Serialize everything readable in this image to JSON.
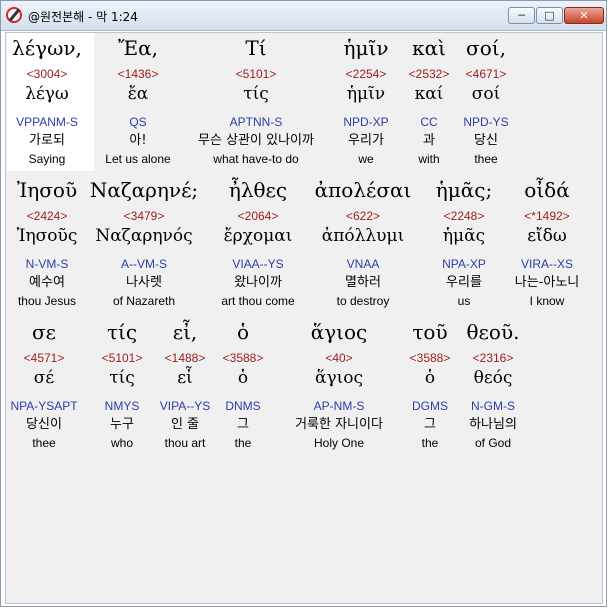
{
  "window": {
    "title": "@원전본해 - 막 1:24"
  },
  "rows": [
    [
      {
        "greek": "λέγων,",
        "num": "<3004>",
        "lemma": "λέγω",
        "parse": "VPPANM-S",
        "kor": "가로되",
        "eng": "Saying"
      },
      {
        "greek": "Ἔα,",
        "num": "<1436>",
        "lemma": "ἔα",
        "parse": "QS",
        "kor": "아!",
        "eng": "Let us alone"
      },
      {
        "greek": "Τί",
        "num": "<5101>",
        "lemma": "τίς",
        "parse": "APTNN-S",
        "kor": "무슨 상관이 있나이까",
        "eng": "what have-to do"
      },
      {
        "greek": "ἡμῖν",
        "num": "<2254>",
        "lemma": "ἡμῖν",
        "parse": "NPD-XP",
        "kor": "우리가",
        "eng": "we"
      },
      {
        "greek": "καὶ",
        "num": "<2532>",
        "lemma": "καί",
        "parse": "CC",
        "kor": "과",
        "eng": "with"
      },
      {
        "greek": "σοί,",
        "num": "<4671>",
        "lemma": "σοί",
        "parse": "NPD-YS",
        "kor": "당신",
        "eng": "thee"
      }
    ],
    [
      {
        "greek": "Ἰησοῦ",
        "num": "<2424>",
        "lemma": "Ἰησοῦς",
        "parse": "N-VM-S",
        "kor": "예수여",
        "eng": "thou Jesus"
      },
      {
        "greek": "Ναζαρηνέ;",
        "num": "<3479>",
        "lemma": "Ναζαρηνός",
        "parse": "A--VM-S",
        "kor": "나사렛",
        "eng": "of Nazareth"
      },
      {
        "greek": "ἦλθες",
        "num": "<2064>",
        "lemma": "ἔρχομαι",
        "parse": "VIAA--YS",
        "kor": "왔나이까",
        "eng": "art thou come"
      },
      {
        "greek": "ἀπολέσαι",
        "num": "<622>",
        "lemma": "ἀπόλλυμι",
        "parse": "VNAA",
        "kor": "멸하러",
        "eng": "to destroy"
      },
      {
        "greek": "ἡμᾶς;",
        "num": "<2248>",
        "lemma": "ἡμᾶς",
        "parse": "NPA-XP",
        "kor": "우리를",
        "eng": "us"
      },
      {
        "greek": "οἶδά",
        "num": "<*1492>",
        "lemma": "εἴδω",
        "parse": "VIRA--XS",
        "kor": "나는-아노니",
        "eng": "I know"
      }
    ],
    [
      {
        "greek": "σε",
        "num": "<4571>",
        "lemma": "σέ",
        "parse": "NPA-YSAPT",
        "kor": "당신이",
        "eng": "thee"
      },
      {
        "greek": "τίς",
        "num": "<5101>",
        "lemma": "τίς",
        "parse": "NMYS",
        "kor": "누구",
        "eng": "who"
      },
      {
        "greek": "εἶ,",
        "num": "<1488>",
        "lemma": "εἶ",
        "parse": "VIPA--YS",
        "kor": "인 줄",
        "eng": "thou art"
      },
      {
        "greek": "ὁ",
        "num": "<3588>",
        "lemma": "ὁ",
        "parse": "DNMS",
        "kor": "그",
        "eng": "the"
      },
      {
        "greek": "ἅγιος",
        "num": "<40>",
        "lemma": "ἅγιος",
        "parse": "AP-NM-S",
        "kor": "거룩한 자니이다",
        "eng": "Holy One"
      },
      {
        "greek": "τοῦ",
        "num": "<3588>",
        "lemma": "ὁ",
        "parse": "DGMS",
        "kor": "그",
        "eng": "the"
      },
      {
        "greek": "θεοῦ.",
        "num": "<2316>",
        "lemma": "θεός",
        "parse": "N-GM-S",
        "kor": "하나님의",
        "eng": "of God"
      }
    ]
  ]
}
